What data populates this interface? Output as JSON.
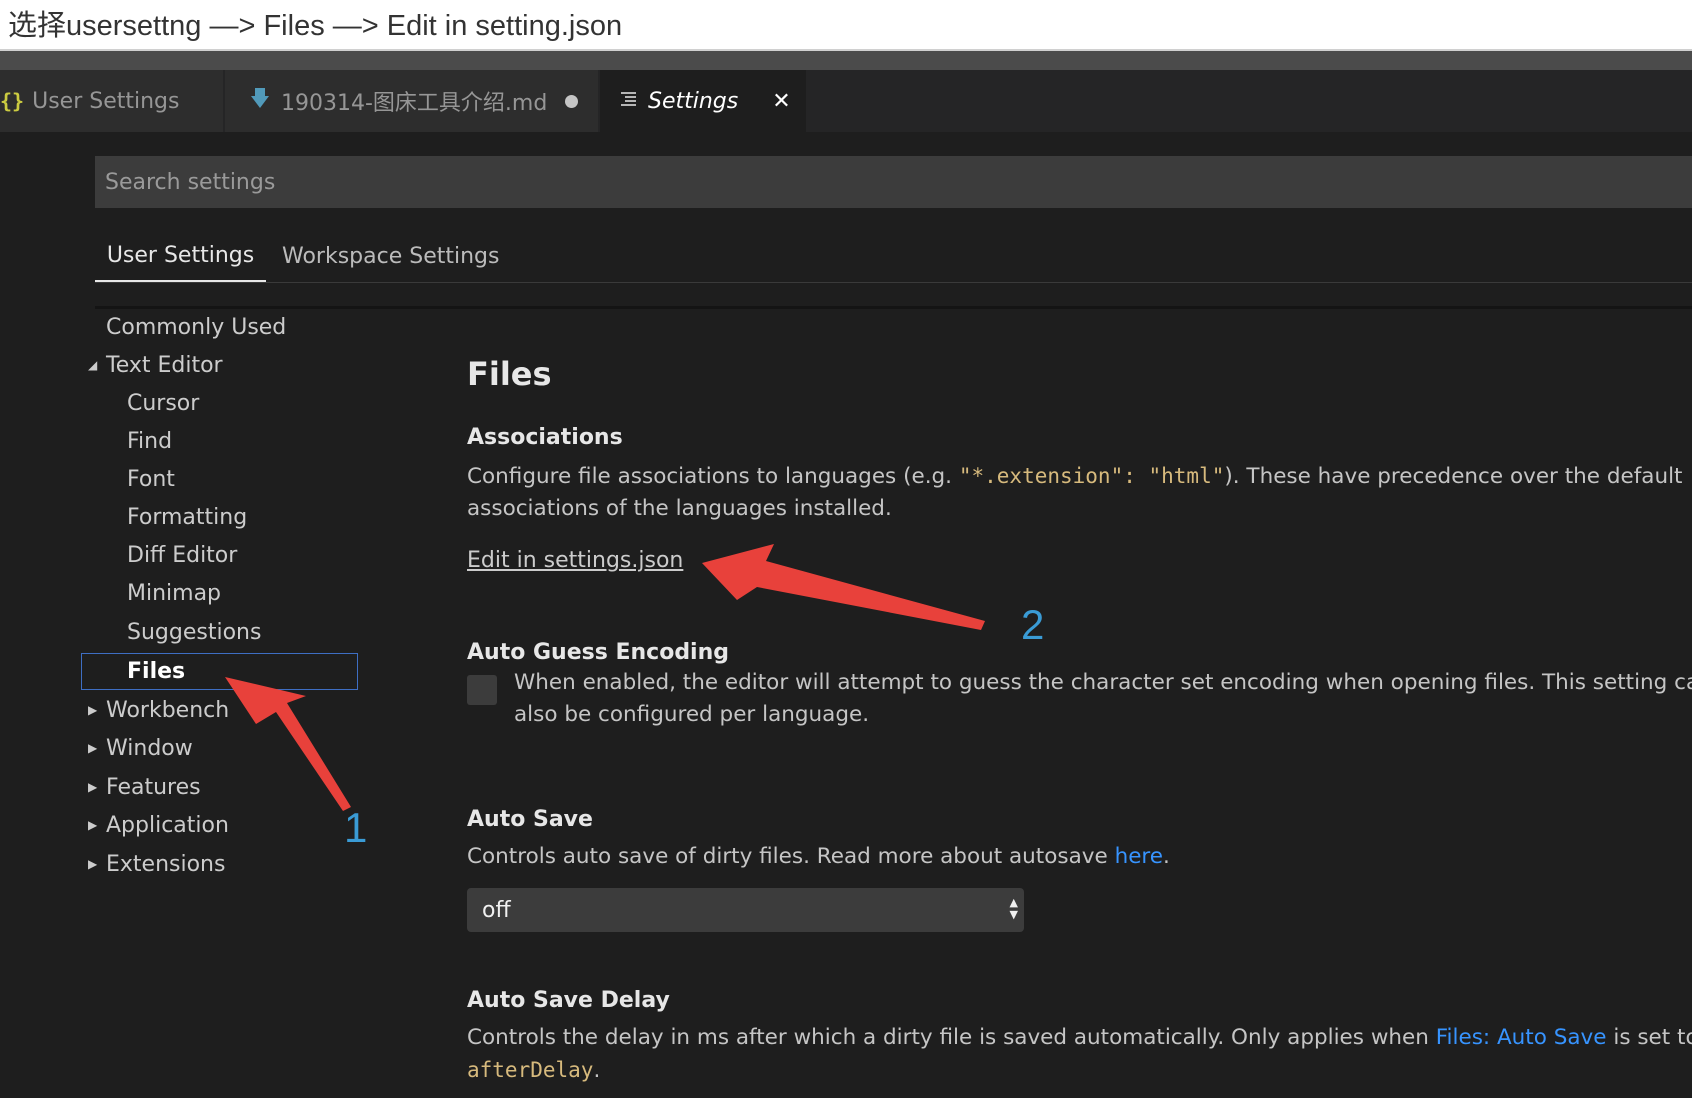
{
  "caption": "选择usersettng —> Files —> Edit in setting.json",
  "tabs": [
    {
      "icon": "json-braces-icon",
      "label": "User Settings",
      "active": false
    },
    {
      "icon": "markdown-icon",
      "label": "190314-图床工具介绍.md",
      "dirty": true,
      "active": false
    },
    {
      "icon": "settings-lines-icon",
      "label": "Settings",
      "active": true
    }
  ],
  "search": {
    "placeholder": "Search settings"
  },
  "scope_tabs": {
    "user": "User Settings",
    "workspace": "Workspace Settings"
  },
  "tree": [
    {
      "label": "Commonly Used",
      "level": 0
    },
    {
      "label": "Text Editor",
      "level": 0,
      "expanded": true
    },
    {
      "label": "Cursor",
      "level": 1
    },
    {
      "label": "Find",
      "level": 1
    },
    {
      "label": "Font",
      "level": 1
    },
    {
      "label": "Formatting",
      "level": 1
    },
    {
      "label": "Diff Editor",
      "level": 1
    },
    {
      "label": "Minimap",
      "level": 1
    },
    {
      "label": "Suggestions",
      "level": 1
    },
    {
      "label": "Files",
      "level": 1,
      "selected": true
    },
    {
      "label": "Workbench",
      "level": 0,
      "expanded": false
    },
    {
      "label": "Window",
      "level": 0,
      "expanded": false
    },
    {
      "label": "Features",
      "level": 0,
      "expanded": false
    },
    {
      "label": "Application",
      "level": 0,
      "expanded": false
    },
    {
      "label": "Extensions",
      "level": 0,
      "expanded": false
    }
  ],
  "section": {
    "title": "Files",
    "associations": {
      "title": "Associations",
      "desc_a": "Configure file associations to languages (e.g. ",
      "desc_code": "\"*.extension\": \"html\"",
      "desc_b": "). These have precedence over the default associations of the languages installed.",
      "edit_link": "Edit in settings.json"
    },
    "auto_guess": {
      "title": "Auto Guess Encoding",
      "desc": "When enabled, the editor will attempt to guess the character set encoding when opening files. This setting can also be configured per language.",
      "checked": false
    },
    "auto_save": {
      "title": "Auto Save",
      "desc_a": "Controls auto save of dirty files. Read more about autosave ",
      "link": "here",
      "desc_b": ".",
      "value": "off"
    },
    "auto_save_delay": {
      "title": "Auto Save Delay",
      "desc_a": "Controls the delay in ms after which a dirty file is saved automatically. Only applies when ",
      "link": "Files: Auto Save",
      "desc_b": " is set to ",
      "code": "afterDelay",
      "desc_c": "."
    }
  },
  "annotations": {
    "one": "1",
    "two": "2"
  },
  "colors": {
    "accent": "#3794ff",
    "arrow": "#e8413b",
    "annotation": "#3a9bd5"
  }
}
